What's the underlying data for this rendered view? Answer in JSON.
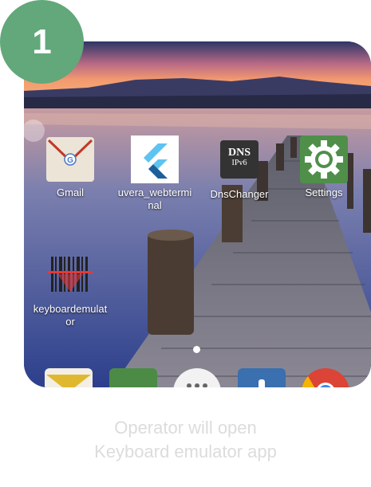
{
  "step": {
    "number": "1"
  },
  "home": {
    "apps": [
      {
        "label": "Gmail"
      },
      {
        "label": "uvera_webterminal"
      },
      {
        "label": "DnsChanger"
      },
      {
        "label": "Settings"
      },
      {
        "label": "keyboardemulator"
      }
    ],
    "dns_icon": {
      "line1": "DNS",
      "line2": "IPv6"
    }
  },
  "caption": {
    "line1": "Operator will open",
    "line2": "Keyboard emulator app"
  },
  "colors": {
    "badge": "#62a87a",
    "caption_text": "#dcdcdc",
    "settings_icon_bg": "#4f8f4a",
    "chrome_red": "#db4437"
  }
}
